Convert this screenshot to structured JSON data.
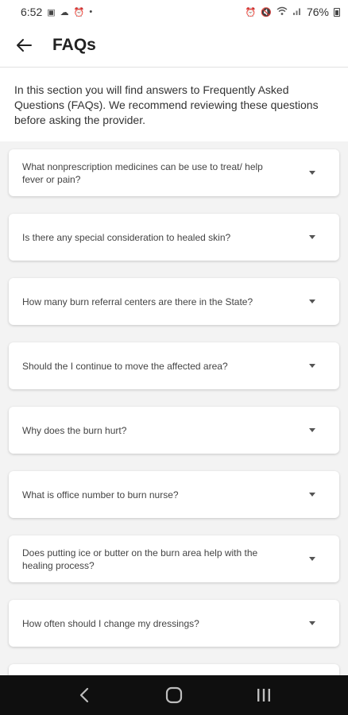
{
  "status_bar": {
    "time": "6:52",
    "battery": "76%",
    "left_icons": [
      "image-icon",
      "cloud-icon",
      "alarm-icon",
      "dot-icon"
    ],
    "right_icons": [
      "alarm-icon",
      "mute-icon",
      "wifi-icon",
      "signal-icon",
      "battery-icon"
    ]
  },
  "app_bar": {
    "title": "FAQs"
  },
  "intro": {
    "text": "In this section you will find answers to Frequently Asked Questions (FAQs). We recommend reviewing these questions before asking the provider."
  },
  "faqs": [
    {
      "question": "What  nonprescription medicines can be use to treat/ help fever or pain?"
    },
    {
      "question": "Is there any special consideration to healed skin?"
    },
    {
      "question": "How many burn referral centers are there in the State?"
    },
    {
      "question": "Should the I continue to move the affected area?"
    },
    {
      "question": "Why does the burn hurt?"
    },
    {
      "question": "What is office number to burn nurse?"
    },
    {
      "question": "Does putting ice or butter on the burn area help with the healing process?"
    },
    {
      "question": "How often should I change my dressings?"
    }
  ],
  "colors": {
    "list_background": "#f3f3f3",
    "nav_background": "#0f0f0f"
  }
}
